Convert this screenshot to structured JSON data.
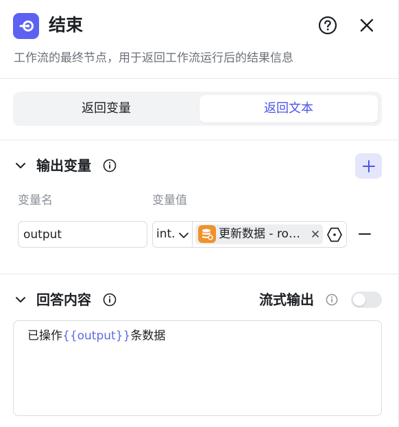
{
  "header": {
    "title": "结束",
    "description": "工作流的最终节点，用于返回工作流运行后的结果信息"
  },
  "mode_tabs": {
    "return_variables": "返回变量",
    "return_text": "返回文本",
    "selected": "返回文本"
  },
  "output_section": {
    "title": "输出变量",
    "column_name_label": "变量名",
    "column_value_label": "变量值",
    "rows": [
      {
        "name": "output",
        "type": "int.",
        "reference": "更新数据 - rowsAffected"
      }
    ]
  },
  "answer_section": {
    "title": "回答内容",
    "stream_label": "流式输出",
    "stream_enabled": false,
    "content_prefix": "已操作",
    "content_variable": "{{output}}",
    "content_suffix": "条数据"
  },
  "colors": {
    "accent": "#4d53e8",
    "logo_bg": "#5d61f2",
    "node_icon_bg": "#f0922e"
  }
}
